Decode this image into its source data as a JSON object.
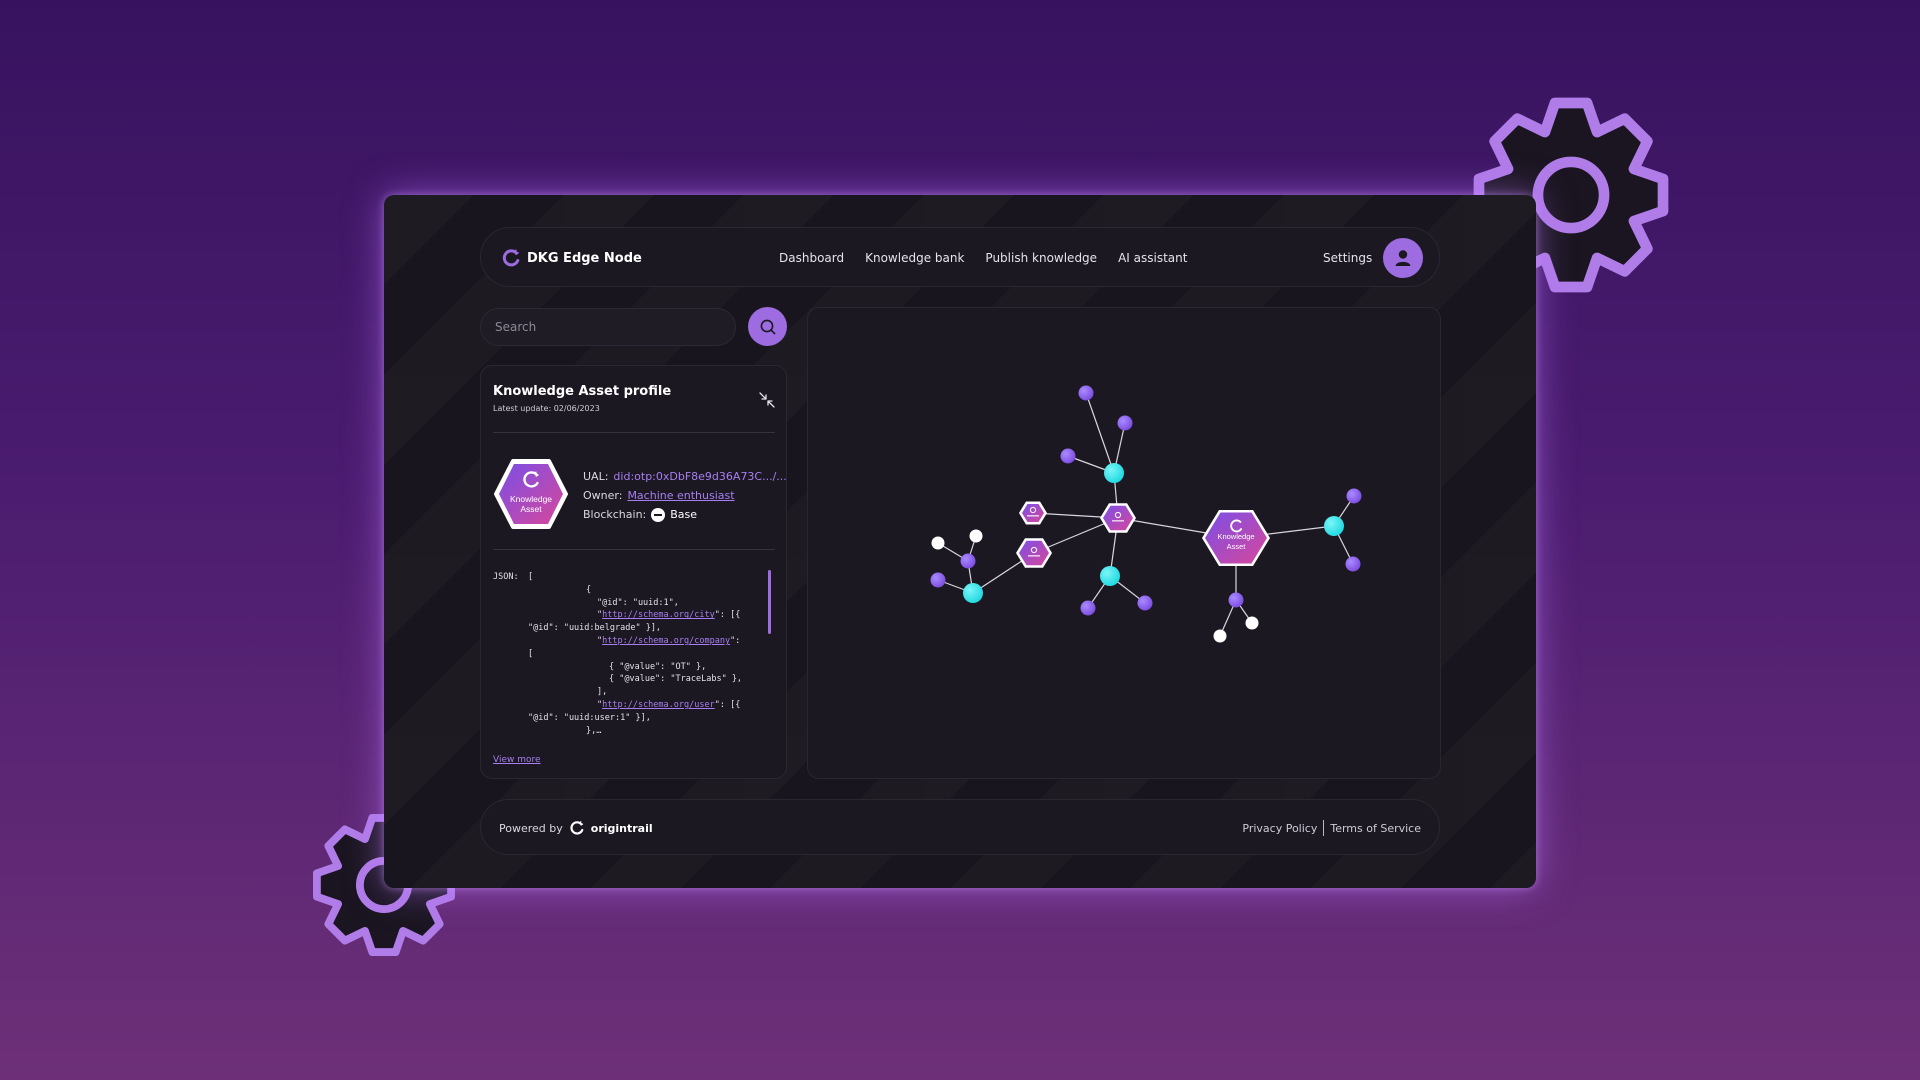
{
  "app": {
    "name": "DKG Edge Node"
  },
  "nav": {
    "items": [
      {
        "label": "Dashboard"
      },
      {
        "label": "Knowledge bank"
      },
      {
        "label": "Publish knowledge"
      },
      {
        "label": "AI assistant"
      }
    ],
    "settings_label": "Settings"
  },
  "search": {
    "placeholder": "Search"
  },
  "profile": {
    "title": "Knowledge Asset profile",
    "latest_update": "Latest update: 02/06/2023",
    "badge_line1": "Knowledge",
    "badge_line2": "Asset",
    "ual_label": "UAL:",
    "ual_value": "did:otp:0xDbF8e9d36A73C.../...",
    "owner_label": "Owner:",
    "owner_value": "Machine enthusiast",
    "blockchain_label": "Blockchain:",
    "blockchain_value": "Base",
    "json_label": "JSON:",
    "json_lines": [
      "[",
      "{",
      "\"@id\": \"uuid:1\",",
      "\"http://schema.org/city\": [{",
      "\"@id\": \"uuid:belgrade\" }],",
      "\"http://schema.org/company\":",
      "[",
      "{ \"@value\": \"OT\" },",
      "{ \"@value\": \"TraceLabs\" },",
      "],",
      "\"http://schema.org/user\": [{",
      "\"@id\": \"uuid:user:1\" }],",
      "},…"
    ],
    "view_more": "View more"
  },
  "graph": {
    "hub_badge_line1": "Knowledge",
    "hub_badge_line2": "Asset",
    "colors": {
      "purple_node": "#7c4be0",
      "cyan_node": "#1fd8e0",
      "white_node": "#ffffff",
      "edge": "#d9d6de"
    }
  },
  "footer": {
    "powered_by": "Powered by",
    "brand": "origintrail",
    "privacy": "Privacy Policy",
    "terms": "Terms of Service"
  },
  "theme": {
    "accent": "#9c6ce0",
    "background_top": "#37135f",
    "background_bottom": "#6d3078"
  }
}
